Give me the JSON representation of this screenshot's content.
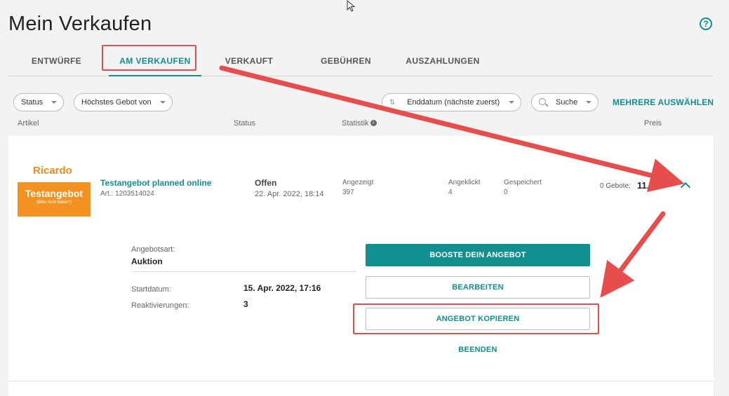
{
  "page": {
    "title": "Mein Verkaufen"
  },
  "tabs": [
    {
      "label": "ENTWÜRFE",
      "active": false
    },
    {
      "label": "AM VERKAUFEN",
      "active": true
    },
    {
      "label": "VERKAUFT",
      "active": false
    },
    {
      "label": "GEBÜHREN",
      "active": false
    },
    {
      "label": "AUSZAHLUNGEN",
      "active": false
    }
  ],
  "filters": {
    "status": "Status",
    "highest_bid": "Höchstes Gebot von",
    "sort": "Enddatum (nächste zuerst)",
    "search_placeholder": "Suche",
    "multi_select": "MEHRERE AUSWÄHLEN"
  },
  "columns": {
    "article": "Artikel",
    "status": "Status",
    "stats": "Statistik",
    "price": "Preis"
  },
  "listing": {
    "brand": "Ricardo",
    "thumb_title": "Testangebot",
    "thumb_sub": "(Bitte nicht bieten!)",
    "title": "Testangebot planned online",
    "article_no": "Art.: 1203514024",
    "status": "Offen",
    "status_date": "22. Apr. 2022, 18:14",
    "stats": [
      {
        "label": "Angezeigt",
        "value": "397"
      },
      {
        "label": "Angeklickt",
        "value": "4"
      },
      {
        "label": "Gespeichert",
        "value": "0"
      }
    ],
    "bids": "0 Gebote:",
    "price": "11.0"
  },
  "details": {
    "type_label": "Angebotsart:",
    "type_value": "Auktion",
    "start_label": "Startdatum:",
    "start_value": "15. Apr. 2022, 17:16",
    "reactivations_label": "Reaktivierungen:",
    "reactivations_value": "3"
  },
  "actions": {
    "boost": "BOOSTE DEIN ANGEBOT",
    "edit": "BEARBEITEN",
    "copy": "ANGEBOT KOPIEREN",
    "end": "BEENDEN"
  },
  "colors": {
    "accent": "#0f8f8f",
    "brand": "#f39221",
    "annotation": "#e84d4d"
  }
}
